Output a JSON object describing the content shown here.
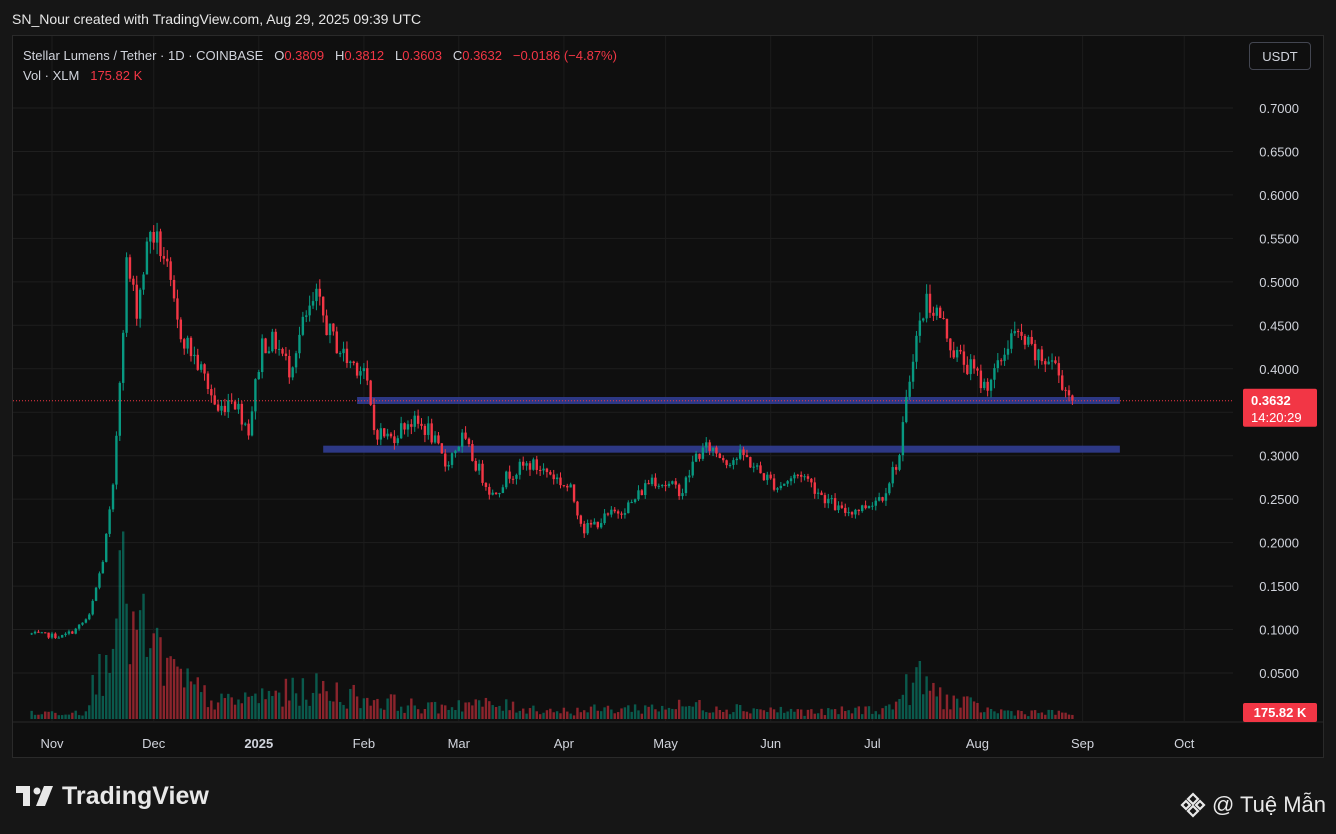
{
  "caption": "SN_Nour created with TradingView.com, Aug 29, 2025 09:39 UTC",
  "legend": {
    "symbol": "Stellar Lumens / Tether · 1D · COINBASE",
    "o_label": "O",
    "o": "0.3809",
    "h_label": "H",
    "h": "0.3812",
    "l_label": "L",
    "l": "0.3603",
    "c_label": "C",
    "c": "0.3632",
    "change": "−0.0186 (−4.87%)",
    "vol_label": "Vol · XLM",
    "vol": "175.82 K"
  },
  "currency_button": "USDT",
  "branding": {
    "logo_text": "TradingView",
    "author": "@ Tuệ Mẫn"
  },
  "colors": {
    "up": "#089981",
    "down": "#f23645",
    "zone": "#2f3b8c",
    "background": "#0f0f0f"
  },
  "icons": {
    "logo": "tradingview-logo-icon",
    "author": "binance-diamond-icon"
  },
  "chart_data": {
    "type": "candlestick",
    "x_ticks": [
      "Nov",
      "Dec",
      "2025",
      "Feb",
      "Mar",
      "Apr",
      "May",
      "Jun",
      "Jul",
      "Aug",
      "Sep",
      "Oct"
    ],
    "y_ticks": [
      "0.7000",
      "0.6500",
      "0.6000",
      "0.5500",
      "0.5000",
      "0.4500",
      "0.4000",
      "0.3500",
      "0.3000",
      "0.2500",
      "0.2000",
      "0.1500",
      "0.1000",
      "0.0500"
    ],
    "ylim": [
      0.0,
      0.72
    ],
    "last_price": "0.3632",
    "countdown": "14:20:29",
    "last_volume": "175.82 K",
    "zones": [
      {
        "from": "2025-01-30",
        "to": "2025-09-12",
        "price": 0.3635
      },
      {
        "from": "2025-01-20",
        "to": "2025-09-12",
        "price": 0.3075
      }
    ],
    "price_path": [
      [
        "2024-10-26",
        0.095
      ],
      [
        "2024-11-04",
        0.092
      ],
      [
        "2024-11-08",
        0.1
      ],
      [
        "2024-11-12",
        0.115
      ],
      [
        "2024-11-16",
        0.18
      ],
      [
        "2024-11-19",
        0.26
      ],
      [
        "2024-11-23",
        0.52
      ],
      [
        "2024-11-26",
        0.47
      ],
      [
        "2024-11-30",
        0.56
      ],
      [
        "2024-12-04",
        0.53
      ],
      [
        "2024-12-08",
        0.45
      ],
      [
        "2024-12-12",
        0.42
      ],
      [
        "2024-12-16",
        0.39
      ],
      [
        "2024-12-20",
        0.35
      ],
      [
        "2024-12-24",
        0.37
      ],
      [
        "2024-12-29",
        0.33
      ],
      [
        "2025-01-02",
        0.43
      ],
      [
        "2025-01-06",
        0.43
      ],
      [
        "2025-01-10",
        0.4
      ],
      [
        "2025-01-14",
        0.45
      ],
      [
        "2025-01-18",
        0.48
      ],
      [
        "2025-01-22",
        0.44
      ],
      [
        "2025-01-27",
        0.41
      ],
      [
        "2025-02-01",
        0.4
      ],
      [
        "2025-02-04",
        0.33
      ],
      [
        "2025-02-09",
        0.32
      ],
      [
        "2025-02-14",
        0.34
      ],
      [
        "2025-02-20",
        0.33
      ],
      [
        "2025-02-25",
        0.29
      ],
      [
        "2025-03-02",
        0.32
      ],
      [
        "2025-03-06",
        0.29
      ],
      [
        "2025-03-11",
        0.255
      ],
      [
        "2025-03-16",
        0.28
      ],
      [
        "2025-03-22",
        0.29
      ],
      [
        "2025-03-28",
        0.28
      ],
      [
        "2025-04-03",
        0.26
      ],
      [
        "2025-04-07",
        0.215
      ],
      [
        "2025-04-14",
        0.23
      ],
      [
        "2025-04-21",
        0.245
      ],
      [
        "2025-04-27",
        0.275
      ],
      [
        "2025-05-02",
        0.265
      ],
      [
        "2025-05-06",
        0.26
      ],
      [
        "2025-05-10",
        0.3
      ],
      [
        "2025-05-14",
        0.31
      ],
      [
        "2025-05-19",
        0.295
      ],
      [
        "2025-05-24",
        0.3
      ],
      [
        "2025-05-29",
        0.28
      ],
      [
        "2025-06-03",
        0.265
      ],
      [
        "2025-06-10",
        0.28
      ],
      [
        "2025-06-16",
        0.255
      ],
      [
        "2025-06-22",
        0.235
      ],
      [
        "2025-06-28",
        0.24
      ],
      [
        "2025-07-04",
        0.255
      ],
      [
        "2025-07-09",
        0.3
      ],
      [
        "2025-07-13",
        0.42
      ],
      [
        "2025-07-17",
        0.48
      ],
      [
        "2025-07-21",
        0.46
      ],
      [
        "2025-07-25",
        0.42
      ],
      [
        "2025-07-30",
        0.4
      ],
      [
        "2025-08-03",
        0.38
      ],
      [
        "2025-08-07",
        0.4
      ],
      [
        "2025-08-11",
        0.44
      ],
      [
        "2025-08-15",
        0.43
      ],
      [
        "2025-08-19",
        0.41
      ],
      [
        "2025-08-23",
        0.41
      ],
      [
        "2025-08-26",
        0.385
      ],
      [
        "2025-08-29",
        0.363
      ]
    ],
    "volume_path": [
      [
        "2024-10-26",
        0.004
      ],
      [
        "2024-11-10",
        0.006
      ],
      [
        "2024-11-16",
        0.04
      ],
      [
        "2024-11-20",
        0.11
      ],
      [
        "2024-11-24",
        0.07
      ],
      [
        "2024-11-30",
        0.055
      ],
      [
        "2024-12-08",
        0.03
      ],
      [
        "2024-12-20",
        0.012
      ],
      [
        "2025-01-05",
        0.018
      ],
      [
        "2025-01-18",
        0.022
      ],
      [
        "2025-02-03",
        0.015
      ],
      [
        "2025-02-20",
        0.008
      ],
      [
        "2025-03-02",
        0.012
      ],
      [
        "2025-04-01",
        0.006
      ],
      [
        "2025-05-10",
        0.01
      ],
      [
        "2025-06-15",
        0.005
      ],
      [
        "2025-07-06",
        0.008
      ],
      [
        "2025-07-14",
        0.03
      ],
      [
        "2025-07-22",
        0.016
      ],
      [
        "2025-08-05",
        0.006
      ],
      [
        "2025-08-29",
        0.004
      ]
    ]
  }
}
